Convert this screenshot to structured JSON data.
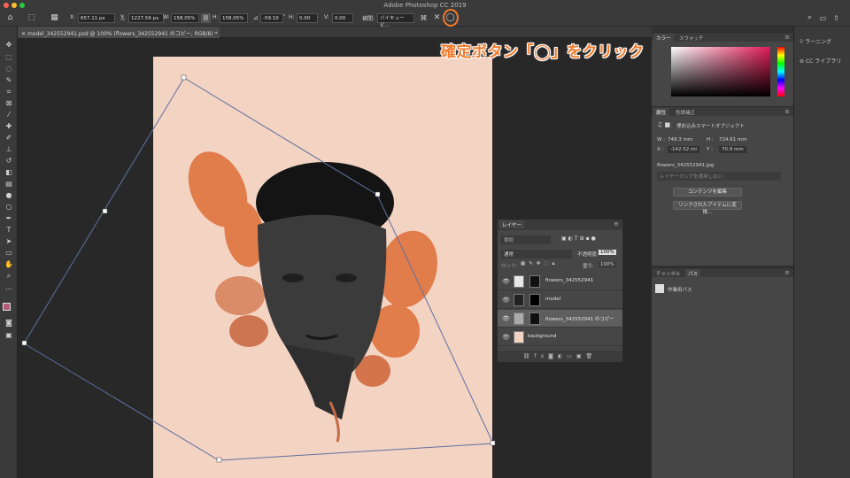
{
  "app": {
    "title": "Adobe Photoshop CC 2019"
  },
  "options_bar": {
    "x_label": "X:",
    "x_value": "657.11 px",
    "y_label": "Y:",
    "y_value": "1227.59 px",
    "w_label": "W:",
    "w_value": "158.05%",
    "h_label": "H:",
    "h_value": "158.05%",
    "angle_value": "-59.10",
    "hskew_label": "H:",
    "hskew_value": "0.00",
    "vskew_label": "V:",
    "vskew_value": "0.00",
    "interp_label": "補間:",
    "interp_value": "バイキュービ…",
    "cancel_symbol": "✕",
    "commit_symbol": "◯"
  },
  "document_tab": {
    "label": "model_342552941.psd @ 100% (flowers_342552941 のコピー, RGB/8) *"
  },
  "annotation": {
    "text": "確定ボタン「◯」をクリック"
  },
  "color_panel": {
    "tabs": [
      "カラー",
      "スウォッチ"
    ]
  },
  "properties_panel": {
    "tabs": [
      "属性",
      "色調補正"
    ],
    "object_type": "埋め込みスマートオブジェクト",
    "w_label": "W :",
    "w_value": "749.3 mm",
    "h_label": "H :",
    "h_value": "724.61 mm",
    "x_label": "X :",
    "x_value": "-142.52 mi",
    "y_label": "Y :",
    "y_value": "70.9 mm",
    "filename": "flowers_342552941.jpg",
    "comp_placeholder": "レイヤーカンプを適用しない",
    "edit_contents_button": "コンテンツを編集",
    "convert_linked_button": "リンクされたアイテムに変換..."
  },
  "channels_panel": {
    "tabs": [
      "チャンネル",
      "パス"
    ],
    "path_name": "作業用パス"
  },
  "right_strip": {
    "items": [
      {
        "label": "ラーニング",
        "icon": "lightbulb-icon"
      },
      {
        "label": "CC ライブラリ",
        "icon": "cc-libraries-icon"
      }
    ]
  },
  "layers_panel": {
    "title": "レイヤー",
    "filter_label": "種類",
    "blend_mode": "通常",
    "opacity_label": "不透明度:",
    "opacity_value": "100%",
    "lock_label": "ロック:",
    "fill_label": "塗り:",
    "fill_value": "100%",
    "layers": [
      {
        "name": "flowers_342552941",
        "selected": false
      },
      {
        "name": "model",
        "selected": false
      },
      {
        "name": "flowers_342552941 のコピー",
        "selected": true
      },
      {
        "name": "background",
        "selected": false
      }
    ]
  },
  "colors": {
    "accent": "#f07a2a",
    "artboard": "#f3d3c2",
    "foreground_swatch": "#b25a78",
    "background_swatch": "#ffffff"
  }
}
